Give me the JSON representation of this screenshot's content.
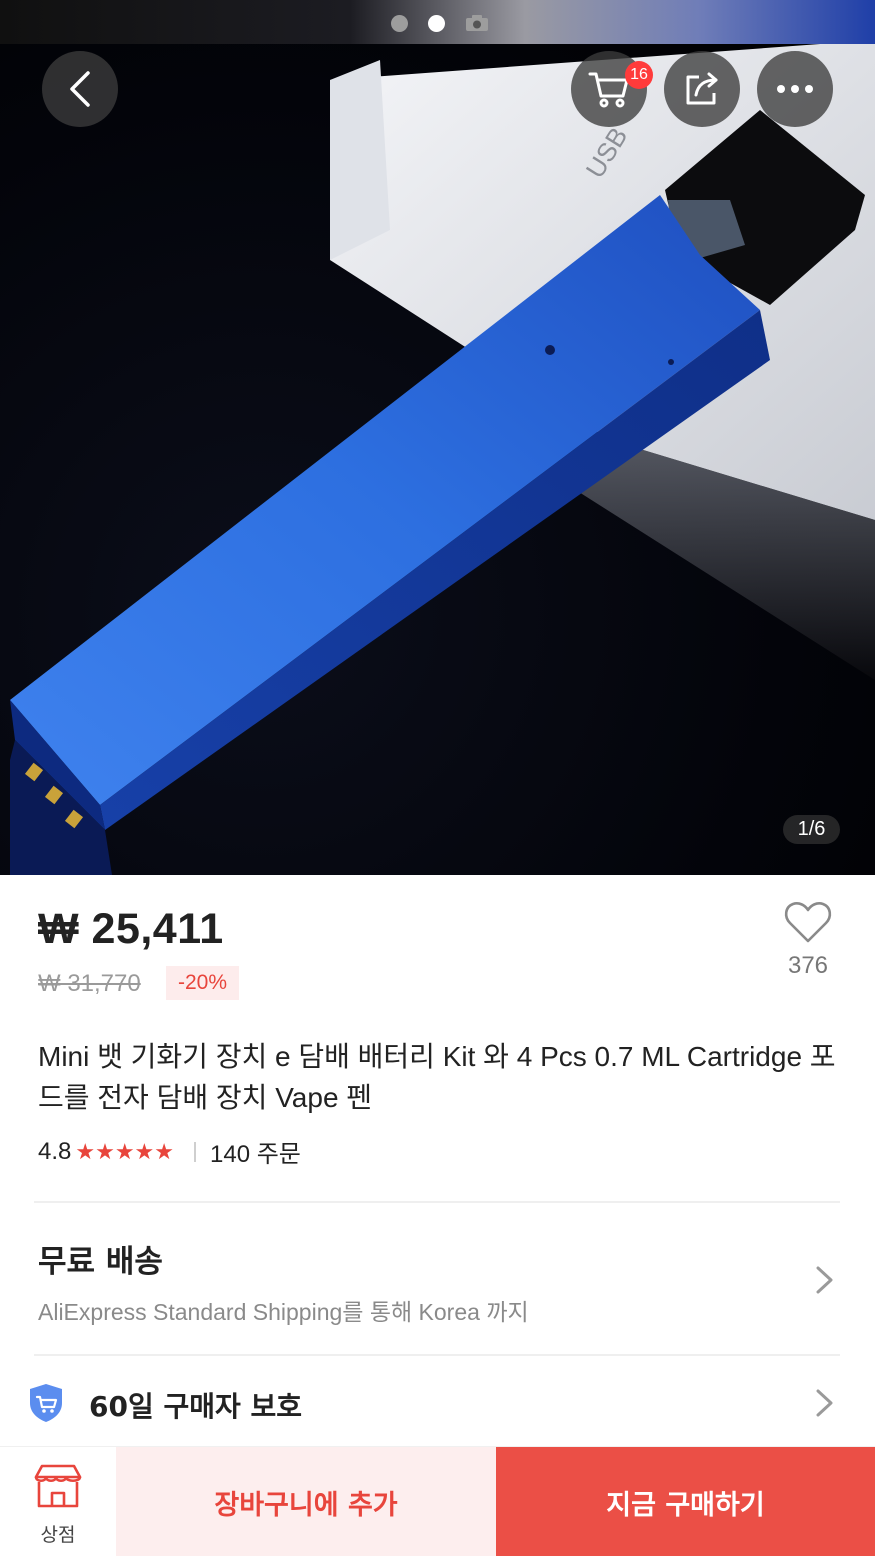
{
  "gallery": {
    "counter": "1/6",
    "cart_badge": "16",
    "image_subject": "blue-vape-device-photo"
  },
  "product": {
    "price": "₩ 25,411",
    "original_price": "₩ 31,770",
    "discount": "-20%",
    "wishlist_count": "376",
    "title": "Mini 뱃 기화기 장치 e 담배 배터리 Kit 와 4 Pcs 0.7 ML Cartridge 포드를 전자 담배 장치 Vape 펜",
    "rating": "4.8",
    "stars": "★★★★★",
    "orders": "140 주문"
  },
  "shipping": {
    "title": "무료 배송",
    "subtitle": "AliExpress Standard Shipping를 통해 Korea 까지"
  },
  "protection": {
    "title": "60일 구매자 보호"
  },
  "bottom_bar": {
    "store_label": "상점",
    "add_to_cart": "장바구니에 추가",
    "buy_now": "지금 구매하기"
  },
  "colors": {
    "accent": "#e8453c",
    "buy_now_bg": "#eb4f46",
    "add_cart_bg": "#fdeeee"
  }
}
